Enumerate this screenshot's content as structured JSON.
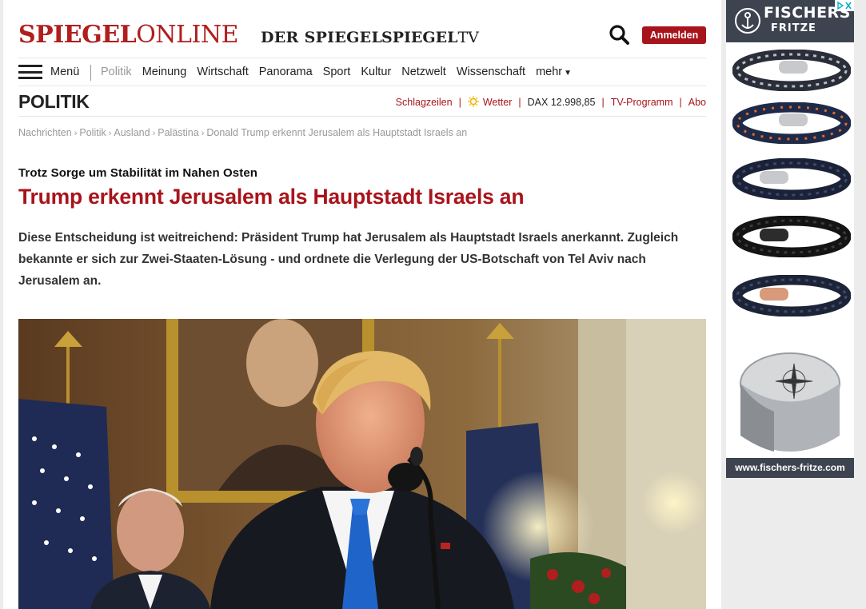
{
  "header": {
    "logo_spiegel": "SPIEGEL",
    "logo_online": "ONLINE",
    "logo_der_spiegel": "DER SPIEGEL",
    "logo_spiegel_tv_a": "SPIEGEL",
    "logo_spiegel_tv_b": "TV",
    "login_label": "Anmelden"
  },
  "nav": {
    "menu_label": "Menü",
    "items": [
      "Politik",
      "Meinung",
      "Wirtschaft",
      "Panorama",
      "Sport",
      "Kultur",
      "Netzwelt",
      "Wissenschaft"
    ],
    "more_label": "mehr",
    "more_caret": "▼"
  },
  "section": {
    "title": "POLITIK",
    "links": {
      "headlines": "Schlagzeilen",
      "weather": "Wetter",
      "dax_label": "DAX",
      "dax_value": "12.998,85",
      "tv": "TV-Programm",
      "abo": "Abo"
    }
  },
  "breadcrumb": [
    "Nachrichten",
    "Politik",
    "Ausland",
    "Palästina",
    "Donald Trump erkennt Jerusalem als Hauptstadt Israels an"
  ],
  "breadcrumb_sep": "›",
  "article": {
    "kicker": "Trotz Sorge um Stabilität im Nahen Osten",
    "headline": "Trump erkennt Jerusalem als Hauptstadt Israels an",
    "intro": "Diese Entscheidung ist weitreichend: Präsident Trump hat Jerusalem als Hauptstadt Israels anerkannt. Zugleich bekannte er sich zur Zwei-Staaten-Lösung - und ordnete die Verlegung der US-Botschaft von Tel Aviv nach Jerusalem an."
  },
  "ad": {
    "brand_top": "FISCHERS",
    "brand_bottom": "FRITZE",
    "footer": "www.fischers-fritze.com"
  },
  "colors": {
    "brand_red": "#a8141b",
    "ad_dark": "#3d4450"
  }
}
